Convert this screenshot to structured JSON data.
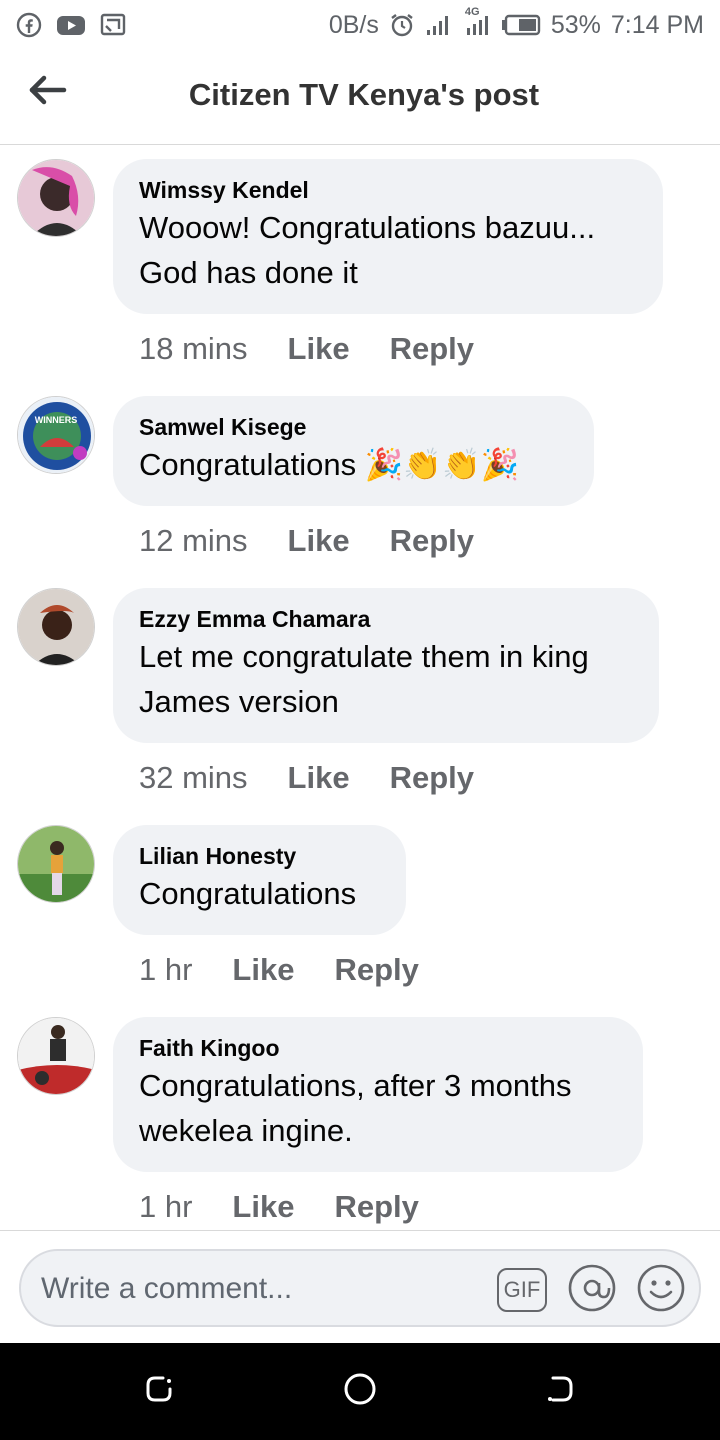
{
  "status_bar": {
    "net_speed": "0B/s",
    "network_type": "4G",
    "battery": "53%",
    "time": "7:14 PM",
    "icons": [
      "facebook-icon",
      "youtube-icon",
      "cast-icon",
      "alarm-icon",
      "signal-icon",
      "battery-icon"
    ]
  },
  "header": {
    "title": "Citizen TV Kenya's post",
    "back_icon": "arrow-left-icon"
  },
  "comments": [
    {
      "author": "Wimssy Kendel",
      "lines": [
        "Wooow! Congratulations bazuu...",
        "God has done it"
      ],
      "time": "18 mins",
      "like": "Like",
      "reply": "Reply",
      "avatar_colors": [
        "#d94ea8",
        "#2f2f2f"
      ]
    },
    {
      "author": "Samwel Kisege",
      "lines": [
        "Congratulations 🎉👏👏🎉"
      ],
      "time": "12 mins",
      "like": "Like",
      "reply": "Reply",
      "avatar_badge": "WINNERS",
      "avatar_colors": [
        "#1f4fa0",
        "#d23c3c"
      ]
    },
    {
      "author": "Ezzy Emma Chamara",
      "lines": [
        "Let me congratulate them in king",
        "James version"
      ],
      "time": "32 mins",
      "like": "Like",
      "reply": "Reply",
      "avatar_colors": [
        "#b04a2c",
        "#3a2218"
      ]
    },
    {
      "author": "Lilian Honesty",
      "lines": [
        "Congratulations"
      ],
      "time": "1 hr",
      "like": "Like",
      "reply": "Reply",
      "avatar_colors": [
        "#4e8a3a",
        "#e6a23a"
      ]
    },
    {
      "author": "Faith Kingoo",
      "lines": [
        "Congratulations, after 3 months",
        "wekelea ingine."
      ],
      "time": "1 hr",
      "like": "Like",
      "reply": "Reply",
      "avatar_colors": [
        "#bf2b2b",
        "#2d2d2d"
      ]
    }
  ],
  "composer": {
    "placeholder": "Write a comment...",
    "gif_label": "GIF",
    "icons": [
      "gif-icon",
      "mention-icon",
      "emoji-icon"
    ]
  },
  "navbar": {
    "icons": [
      "recent-apps-icon",
      "home-icon",
      "back-nav-icon"
    ]
  },
  "colors": {
    "bubble": "#f0f2f5",
    "meta_text": "#65676b",
    "title_text": "#333333",
    "icon_gray": "#5f6368"
  }
}
